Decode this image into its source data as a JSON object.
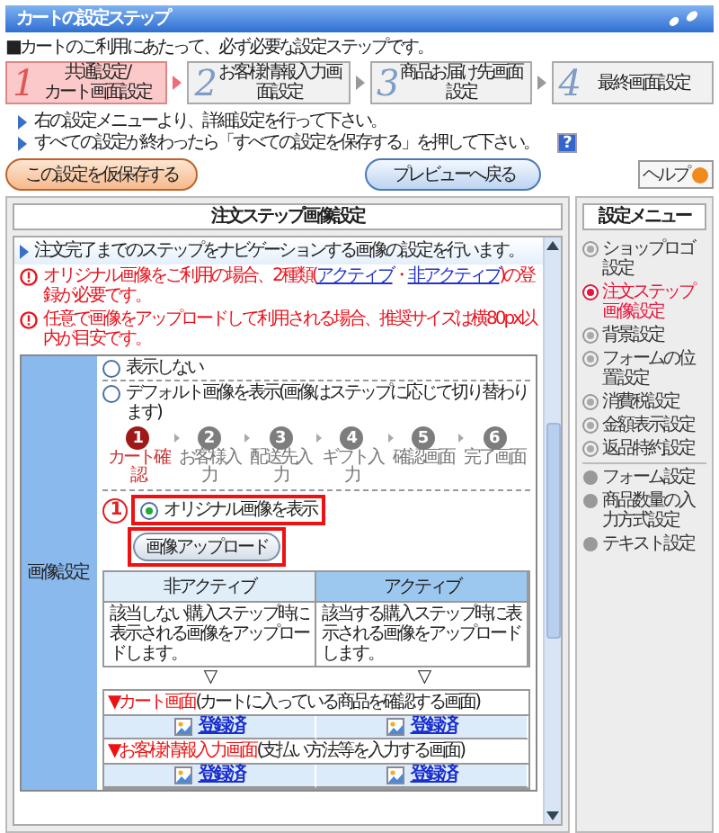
{
  "window": {
    "title": "カートの設定ステップ"
  },
  "intro": "■カートのご利用にあたって、必ず必要な設定ステップです。",
  "steps": [
    {
      "number": "1",
      "label": "共通設定/\nカート画面設定",
      "selected": true
    },
    {
      "number": "2",
      "label": "お客様情報入力画面設定",
      "selected": false
    },
    {
      "number": "3",
      "label": "商品お届け先画面設定",
      "selected": false
    },
    {
      "number": "4",
      "label": "最終画面設定",
      "selected": false
    }
  ],
  "instructions": [
    "右の設定メニューより、詳細設定を行って下さい。",
    "すべての設定が終わったら「すべての設定を保存する」を押して下さい。"
  ],
  "help_mark": "?",
  "buttons": {
    "save": "この設定を仮保存する",
    "preview": "プレビューへ戻る",
    "help": "ヘルプ"
  },
  "panel": {
    "title": "注文ステップ画像設定",
    "description": "注文完了までのステップをナビゲーションする画像の設定を行います。",
    "notes": [
      {
        "segments": [
          {
            "kind": "text",
            "text": "オリジナル画像をご利用の場合、2種類("
          },
          {
            "kind": "link",
            "text": "アクティブ"
          },
          {
            "kind": "text",
            "text": "・"
          },
          {
            "kind": "link",
            "text": "非アクティブ"
          },
          {
            "kind": "text",
            "text": ")の登録が必要です。"
          }
        ]
      },
      {
        "segments": [
          {
            "kind": "text",
            "text": "任意で画像をアップロードして利用される場合、推奨サイズは横80px以内が目安です。"
          }
        ]
      }
    ],
    "row_label": "画像設定",
    "options": [
      {
        "label": "表示しない",
        "selected": false
      },
      {
        "label": "デフォルト画像を表示(画像はステップに応じて切り替わります)",
        "selected": false
      },
      {
        "label": "オリジナル画像を表示",
        "selected": true
      }
    ],
    "step_preview": [
      {
        "number": "1",
        "label": "カート確認",
        "selected": true
      },
      {
        "number": "2",
        "label": "お客様入力",
        "selected": false
      },
      {
        "number": "3",
        "label": "配送先入力",
        "selected": false
      },
      {
        "number": "4",
        "label": "ギフト入力",
        "selected": false
      },
      {
        "number": "5",
        "label": "確認画面",
        "selected": false
      },
      {
        "number": "6",
        "label": "完了画面",
        "selected": false
      }
    ],
    "callout": "1",
    "upload_button": "画像アップロード",
    "columns": [
      {
        "title": "非アクティブ",
        "description": "該当しない購入ステップ時に表示される画像をアップロードします。",
        "highlighted": false,
        "arrow": "▽"
      },
      {
        "title": "アクティブ",
        "description": "該当する購入ステップ時に表示される画像をアップロードします。",
        "highlighted": true,
        "arrow": "▽"
      }
    ],
    "screens": [
      {
        "title": "▼カート画面",
        "note": "(カートに入っている商品を確認する画面)",
        "files": [
          "登録済",
          "登録済"
        ]
      },
      {
        "title": "▼お客様情報入力画面",
        "note": "(支払い方法等を入力する画面)",
        "files": [
          "登録済",
          "登録済"
        ]
      }
    ]
  },
  "menu": {
    "title": "設定メニュー",
    "groups": [
      [
        {
          "label": "ショップロゴ設定",
          "selected": false,
          "kind": "radio"
        },
        {
          "label": "注文ステップ画像設定",
          "selected": true,
          "kind": "radio"
        },
        {
          "label": "背景設定",
          "selected": false,
          "kind": "radio"
        },
        {
          "label": "フォームの位置設定",
          "selected": false,
          "kind": "radio"
        },
        {
          "label": "消費税設定",
          "selected": false,
          "kind": "radio"
        },
        {
          "label": "金額表示設定",
          "selected": false,
          "kind": "radio"
        },
        {
          "label": "返品特約設定",
          "selected": false,
          "kind": "radio"
        }
      ],
      [
        {
          "label": "フォーム設定",
          "selected": false,
          "kind": "dot"
        },
        {
          "label": "商品数量の入力方式設定",
          "selected": false,
          "kind": "dot"
        },
        {
          "label": "テキスト設定",
          "selected": false,
          "kind": "dot"
        }
      ]
    ]
  }
}
